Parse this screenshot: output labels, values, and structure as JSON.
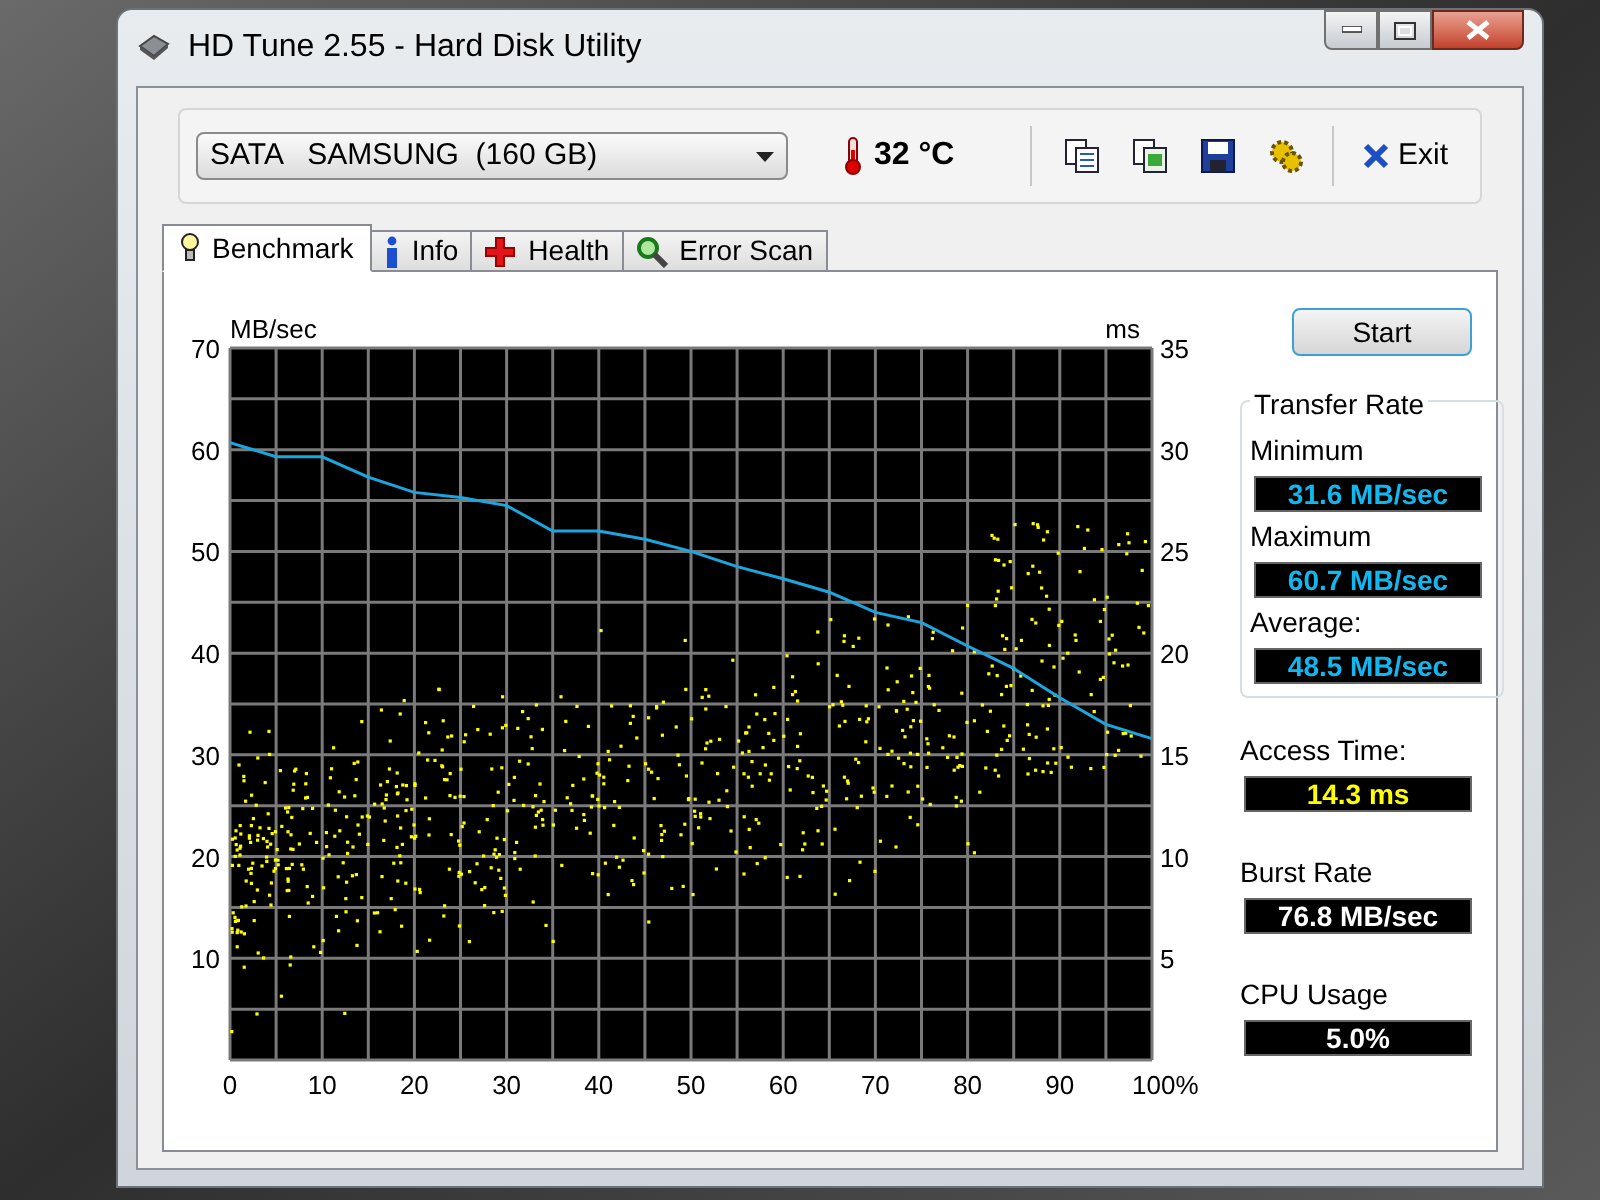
{
  "window": {
    "title": "HD Tune 2.55 - Hard Disk Utility"
  },
  "drive_select": {
    "value": "SATA   SAMSUNG  (160 GB)"
  },
  "temperature": "32 °C",
  "toolbar": {
    "exit": "Exit"
  },
  "tabs": [
    {
      "label": "Benchmark",
      "selected": true,
      "kind": "bulb"
    },
    {
      "label": "Info",
      "selected": false,
      "kind": "info"
    },
    {
      "label": "Health",
      "selected": false,
      "kind": "cross"
    },
    {
      "label": "Error Scan",
      "selected": false,
      "kind": "magnifier"
    }
  ],
  "benchmark": {
    "start_button": "Start",
    "chart_data": {
      "type": "line",
      "ylabel": "MB/sec",
      "y2label": "ms",
      "x": [
        0,
        5,
        10,
        15,
        20,
        25,
        30,
        35,
        40,
        45,
        50,
        55,
        60,
        65,
        70,
        75,
        80,
        85,
        90,
        95,
        100
      ],
      "grid": true,
      "series": [
        {
          "color": "#1aa7e0",
          "values": [
            60.7,
            59.3,
            59.3,
            57.3,
            55.8,
            55.3,
            54.5,
            52,
            52,
            51.2,
            50,
            48.5,
            47.3,
            46,
            44,
            43,
            40.7,
            38.5,
            35.6,
            33,
            31.6
          ]
        }
      ],
      "xlim": [
        0,
        100
      ],
      "ylim": [
        0,
        70
      ],
      "xticks": [
        0,
        10,
        20,
        30,
        40,
        50,
        60,
        70,
        80,
        90,
        {
          "value": 100,
          "label": "100%"
        }
      ],
      "yticks": [
        10,
        20,
        30,
        40,
        50,
        60,
        70
      ],
      "y2lim": [
        0,
        35
      ],
      "y2ticks": [
        5,
        10,
        15,
        20,
        25,
        30,
        35
      ]
    },
    "transfer_rate": {
      "title": "Transfer Rate",
      "stats": [
        {
          "label": "Minimum",
          "value": "31.6 MB/sec"
        },
        {
          "label": "Maximum",
          "value": "60.7 MB/sec"
        },
        {
          "label": "Average:",
          "value": "48.5 MB/sec"
        }
      ]
    },
    "readings": [
      {
        "label": "Access Time:",
        "value": "14.3 ms",
        "kind": "time"
      },
      {
        "label": "Burst Rate",
        "value": "76.8 MB/sec",
        "kind": "rate"
      },
      {
        "label": "CPU Usage",
        "value": "5.0%",
        "kind": "usage"
      }
    ]
  }
}
